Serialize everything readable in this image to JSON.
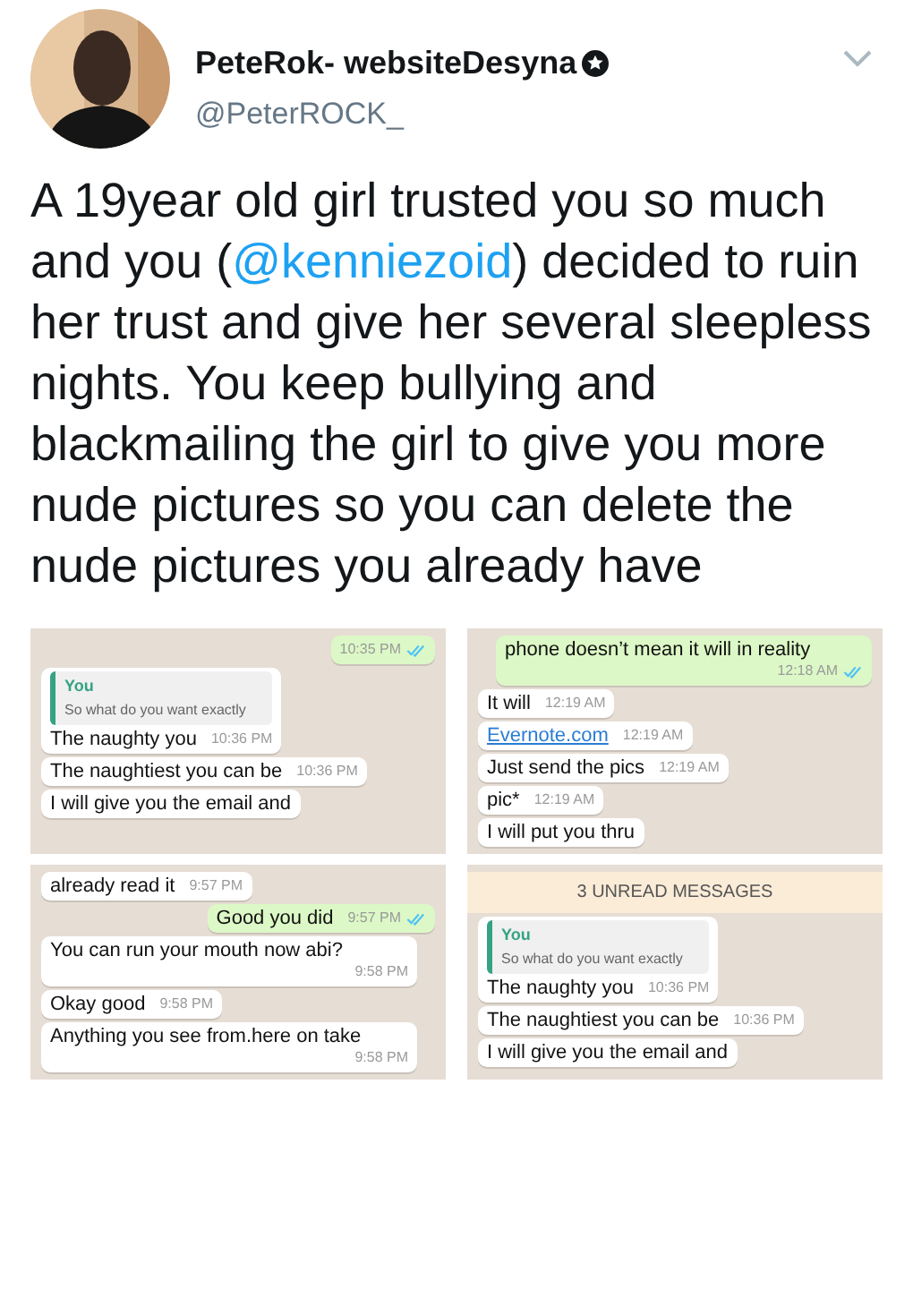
{
  "author": {
    "name": "PeteRok- websiteDesyna",
    "handle": "@PeterROCK_",
    "verified": true
  },
  "tweet_text": [
    {
      "kind": "text",
      "text": "A 19year old girl trusted you so much and you ("
    },
    {
      "kind": "mention",
      "text": "@kenniezoid"
    },
    {
      "kind": "text",
      "text": ") decided to ruin her trust and give her several sleepless nights. You keep bullying and blackmailing the girl to give you more nude pictures so you can delete the nude pictures you already have"
    }
  ],
  "chat_panels": [
    {
      "messages": [
        {
          "kind": "out",
          "time": "10:35 PM",
          "read": true
        },
        {
          "kind": "reply",
          "quote_author": "You",
          "quote_text": "So what do you want exactly",
          "text": "The naughty you",
          "time": "10:36 PM"
        },
        {
          "kind": "in",
          "text": "The naughtiest you can be",
          "time": "10:36 PM"
        },
        {
          "kind": "in",
          "text": "I will give you the email and"
        }
      ]
    },
    {
      "messages": [
        {
          "kind": "out",
          "text": "phone doesn’t mean it will in reality",
          "time": "12:18 AM",
          "read": true
        },
        {
          "kind": "in",
          "text": "It will",
          "time": "12:19 AM"
        },
        {
          "kind": "in",
          "text": "Evernote.com",
          "time": "12:19 AM",
          "link": true
        },
        {
          "kind": "in",
          "text": "Just send the pics",
          "time": "12:19 AM"
        },
        {
          "kind": "in",
          "text": "pic*",
          "time": "12:19 AM"
        },
        {
          "kind": "in",
          "text": "I will put you thru"
        }
      ]
    },
    {
      "messages": [
        {
          "kind": "in",
          "text": "already read it",
          "time": "9:57 PM"
        },
        {
          "kind": "out",
          "text": "Good you did",
          "time": "9:57 PM",
          "read": true
        },
        {
          "kind": "in",
          "text": "You can run your mouth now abi?",
          "time": "9:58 PM"
        },
        {
          "kind": "in",
          "text": "Okay good",
          "time": "9:58 PM"
        },
        {
          "kind": "in",
          "text": "Anything you see from.here on take",
          "time": "9:58 PM"
        }
      ]
    },
    {
      "messages": [
        {
          "kind": "unread",
          "text": "3 UNREAD MESSAGES"
        },
        {
          "kind": "reply",
          "quote_author": "You",
          "quote_text": "So what do you want exactly",
          "text": "The naughty you",
          "time": "10:36 PM"
        },
        {
          "kind": "in",
          "text": "The naughtiest you can be",
          "time": "10:36 PM"
        },
        {
          "kind": "in",
          "text": "I will give you the email and"
        }
      ]
    }
  ]
}
